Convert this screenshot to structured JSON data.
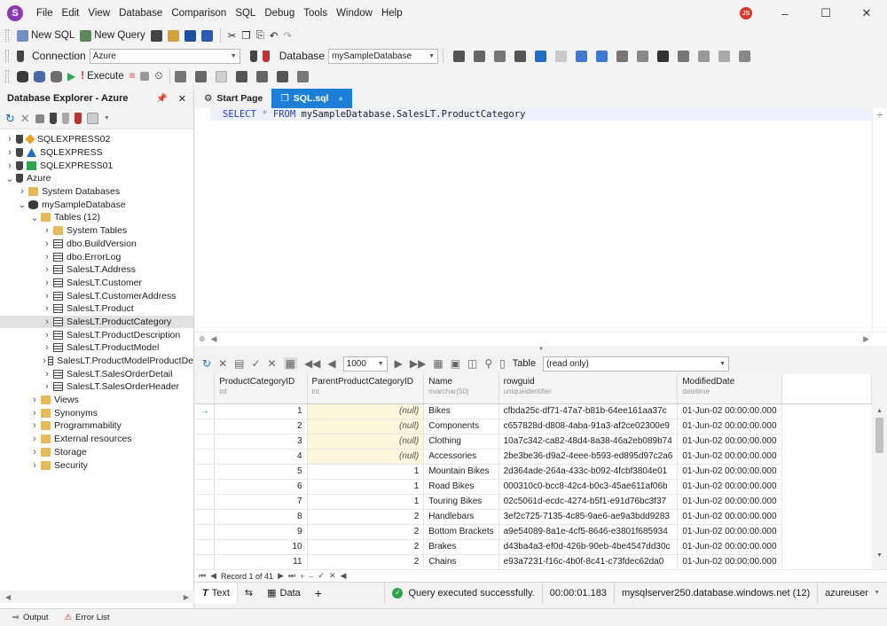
{
  "app": {
    "logo": "S",
    "menu": [
      "File",
      "Edit",
      "View",
      "Database",
      "Comparison",
      "SQL",
      "Debug",
      "Tools",
      "Window",
      "Help"
    ],
    "user_initials": "JS"
  },
  "toolbar1": {
    "new_sql": "New SQL",
    "new_query": "New Query"
  },
  "toolbar2": {
    "connection_label": "Connection",
    "connection_value": "Azure",
    "database_label": "Database",
    "database_value": "mySampleDatabase"
  },
  "toolbar3": {
    "execute": "Execute"
  },
  "explorer": {
    "title": "Database Explorer - Azure",
    "items": [
      {
        "label": "SQLEXPRESS02",
        "depth": 0,
        "icon": "server-orange-icon",
        "expanded": false
      },
      {
        "label": "SQLEXPRESS",
        "depth": 0,
        "icon": "server-blue-icon",
        "expanded": false
      },
      {
        "label": "SQLEXPRESS01",
        "depth": 0,
        "icon": "server-green-icon",
        "expanded": false
      },
      {
        "label": "Azure",
        "depth": 0,
        "icon": "plug-icon",
        "expanded": true
      },
      {
        "label": "System Databases",
        "depth": 1,
        "icon": "folder-icon",
        "expanded": false
      },
      {
        "label": "mySampleDatabase",
        "depth": 1,
        "icon": "database-icon",
        "expanded": true
      },
      {
        "label": "Tables (12)",
        "depth": 2,
        "icon": "folder-open-icon",
        "expanded": true
      },
      {
        "label": "System Tables",
        "depth": 3,
        "icon": "folder-icon",
        "expanded": false
      },
      {
        "label": "dbo.BuildVersion",
        "depth": 3,
        "icon": "table-icon",
        "expanded": false
      },
      {
        "label": "dbo.ErrorLog",
        "depth": 3,
        "icon": "table-icon",
        "expanded": false
      },
      {
        "label": "SalesLT.Address",
        "depth": 3,
        "icon": "table-icon",
        "expanded": false
      },
      {
        "label": "SalesLT.Customer",
        "depth": 3,
        "icon": "table-icon",
        "expanded": false
      },
      {
        "label": "SalesLT.CustomerAddress",
        "depth": 3,
        "icon": "table-icon",
        "expanded": false
      },
      {
        "label": "SalesLT.Product",
        "depth": 3,
        "icon": "table-icon",
        "expanded": false
      },
      {
        "label": "SalesLT.ProductCategory",
        "depth": 3,
        "icon": "table-icon",
        "expanded": false,
        "selected": true
      },
      {
        "label": "SalesLT.ProductDescription",
        "depth": 3,
        "icon": "table-icon",
        "expanded": false
      },
      {
        "label": "SalesLT.ProductModel",
        "depth": 3,
        "icon": "table-icon",
        "expanded": false
      },
      {
        "label": "SalesLT.ProductModelProductDe",
        "depth": 3,
        "icon": "table-icon",
        "expanded": false
      },
      {
        "label": "SalesLT.SalesOrderDetail",
        "depth": 3,
        "icon": "table-icon",
        "expanded": false
      },
      {
        "label": "SalesLT.SalesOrderHeader",
        "depth": 3,
        "icon": "table-icon",
        "expanded": false
      },
      {
        "label": "Views",
        "depth": 2,
        "icon": "folder-icon",
        "expanded": false
      },
      {
        "label": "Synonyms",
        "depth": 2,
        "icon": "folder-icon",
        "expanded": false
      },
      {
        "label": "Programmability",
        "depth": 2,
        "icon": "folder-icon",
        "expanded": false
      },
      {
        "label": "External resources",
        "depth": 2,
        "icon": "folder-icon",
        "expanded": false
      },
      {
        "label": "Storage",
        "depth": 2,
        "icon": "folder-icon",
        "expanded": false
      },
      {
        "label": "Security",
        "depth": 2,
        "icon": "folder-icon",
        "expanded": false
      }
    ]
  },
  "tabs": [
    {
      "label": "Start Page",
      "active": false
    },
    {
      "label": "SQL.sql",
      "active": true
    }
  ],
  "editor": {
    "sql_parts": [
      "SELECT",
      " * ",
      "FROM",
      " mySampleDatabase.SalesLT.ProductCategory"
    ]
  },
  "grid_toolbar": {
    "page_size": "1000",
    "view_label": "Table",
    "view_value": "(read only)"
  },
  "grid": {
    "columns": [
      {
        "name": "ProductCategoryID",
        "type": "int"
      },
      {
        "name": "ParentProductCategoryID",
        "type": "int"
      },
      {
        "name": "Name",
        "type": "nvarchar(50)"
      },
      {
        "name": "rowguid",
        "type": "uniqueidentifier"
      },
      {
        "name": "ModifiedDate",
        "type": "datetime"
      }
    ],
    "rows": [
      [
        "1",
        "(null)",
        "Bikes",
        "cfbda25c-df71-47a7-b81b-64ee161aa37c",
        "01-Jun-02 00:00:00.000"
      ],
      [
        "2",
        "(null)",
        "Components",
        "c657828d-d808-4aba-91a3-af2ce02300e9",
        "01-Jun-02 00:00:00.000"
      ],
      [
        "3",
        "(null)",
        "Clothing",
        "10a7c342-ca82-48d4-8a38-46a2eb089b74",
        "01-Jun-02 00:00:00.000"
      ],
      [
        "4",
        "(null)",
        "Accessories",
        "2be3be36-d9a2-4eee-b593-ed895d97c2a6",
        "01-Jun-02 00:00:00.000"
      ],
      [
        "5",
        "1",
        "Mountain Bikes",
        "2d364ade-264a-433c-b092-4fcbf3804e01",
        "01-Jun-02 00:00:00.000"
      ],
      [
        "6",
        "1",
        "Road Bikes",
        "000310c0-bcc8-42c4-b0c3-45ae611af06b",
        "01-Jun-02 00:00:00.000"
      ],
      [
        "7",
        "1",
        "Touring Bikes",
        "02c5061d-ecdc-4274-b5f1-e91d76bc3f37",
        "01-Jun-02 00:00:00.000"
      ],
      [
        "8",
        "2",
        "Handlebars",
        "3ef2c725-7135-4c85-9ae6-ae9a3bdd9283",
        "01-Jun-02 00:00:00.000"
      ],
      [
        "9",
        "2",
        "Bottom Brackets",
        "a9e54089-8a1e-4cf5-8646-e3801f685934",
        "01-Jun-02 00:00:00.000"
      ],
      [
        "10",
        "2",
        "Brakes",
        "d43ba4a3-ef0d-426b-90eb-4be4547dd30c",
        "01-Jun-02 00:00:00.000"
      ],
      [
        "11",
        "2",
        "Chains",
        "e93a7231-f16c-4b0f-8c41-c73fdec62da0",
        "01-Jun-02 00:00:00.000"
      ]
    ]
  },
  "grid_nav": {
    "record": "Record 1 of 41"
  },
  "status": {
    "text_tab": "Text",
    "data_tab": "Data",
    "message": "Query executed successfully.",
    "elapsed": "00:00:01.183",
    "server": "mysqlserver250.database.windows.net (12)",
    "user": "azureuser"
  },
  "bottom": {
    "output": "Output",
    "error_list": "Error List"
  }
}
